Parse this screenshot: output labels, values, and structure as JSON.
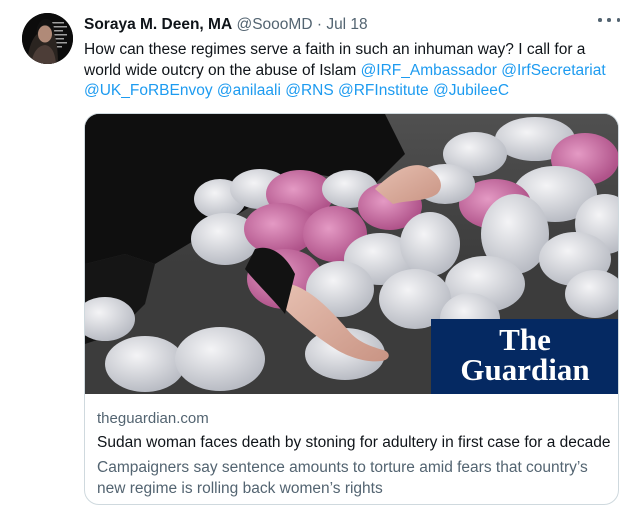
{
  "tweet": {
    "author_name": "Soraya M. Deen, MA",
    "author_handle": "@SoooMD",
    "separator": "·",
    "date": "Jul 18",
    "text_main": "How can these regimes serve a faith in such an inhuman way? I call for a world wide outcry on the abuse of Islam",
    "mentions": [
      "@IRF_Ambassador",
      "@IrfSecretariat",
      "@UK_FoRBEnvoy",
      "@anilaali",
      "@RNS",
      "@RFInstitute",
      "@JubileeC"
    ],
    "more_icon": "more-horizontal-icon"
  },
  "card": {
    "image_alt": "Pile of white and pink stones with a hand reaching toward them",
    "brand_line1": "The",
    "brand_line2": "Guardian",
    "brand_color": "#052962",
    "domain": "theguardian.com",
    "title": "Sudan woman faces death by stoning for adultery in first case for a decade",
    "description": "Campaigners say sentence amounts to torture amid fears that country’s new regime is rolling back women’s rights"
  },
  "colors": {
    "link": "#1d9bf0",
    "secondary_text": "#536471",
    "border": "#cfd9de"
  }
}
